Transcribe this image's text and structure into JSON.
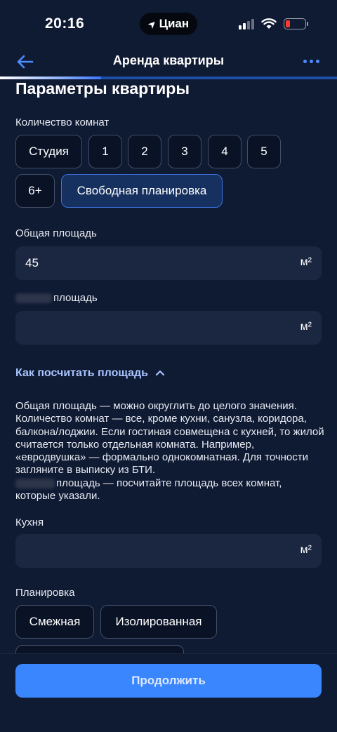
{
  "status_bar": {
    "time": "20:16",
    "carrier": "Циан"
  },
  "nav": {
    "title": "Аренда квартиры"
  },
  "progress": {
    "fraction": 0.3
  },
  "page": {
    "heading": "Параметры квартиры"
  },
  "rooms": {
    "label": "Количество комнат",
    "options": [
      "Студия",
      "1",
      "2",
      "3",
      "4",
      "5",
      "6+",
      "Свободная планировка"
    ],
    "selected": "Свободная планировка"
  },
  "total_area": {
    "label": "Общая площадь",
    "value": "45",
    "unit": "м²"
  },
  "living_area": {
    "label": "площадь",
    "value": "",
    "unit": "м²"
  },
  "howto": {
    "label": "Как посчитать площадь"
  },
  "help": {
    "text": "Общая площадь — можно округлить до целого значения. Количество комнат — все, кроме кухни, санузла, коридора, балкона/лоджии. Если гостиная совмещена с кухней, то жилой считается только отдельная комната. Например, «евродвушка» — формально однокомнатная. Для точности загляните в выписку из БТИ.",
    "text2": "площадь — посчитайте площадь всех комнат, которые указали."
  },
  "kitchen": {
    "label": "Кухня",
    "value": "",
    "unit": "м²"
  },
  "layout": {
    "label": "Планировка",
    "options": [
      "Смежная",
      "Изолированная"
    ]
  },
  "actions": {
    "continue_label": "Продолжить"
  }
}
